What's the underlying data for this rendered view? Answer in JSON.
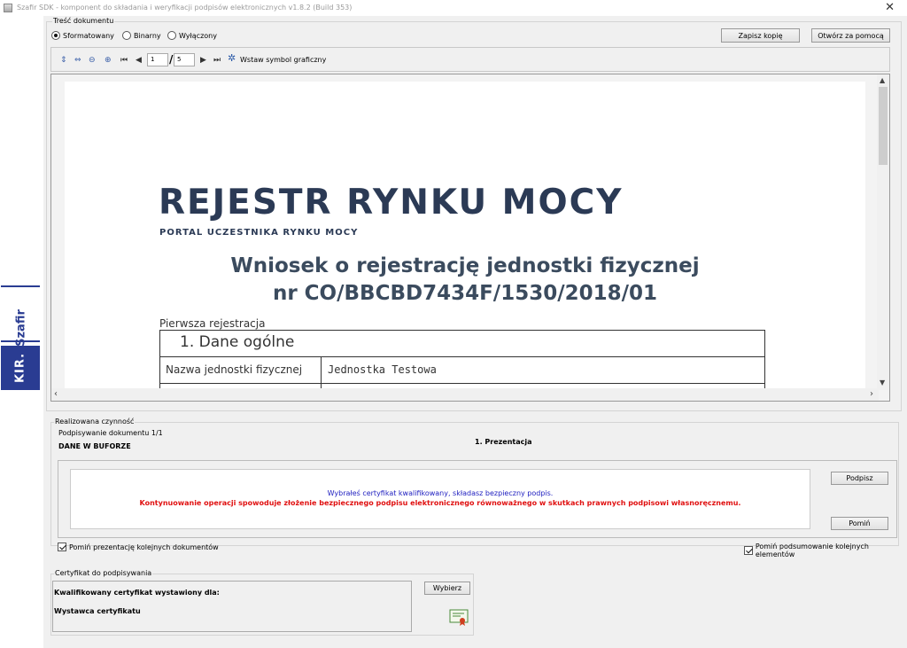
{
  "window": {
    "title": "Szafir SDK - komponent do składania i weryfikacji podpisów elektronicznych v1.8.2 (Build 353)",
    "close_glyph": "✕"
  },
  "brand": {
    "product": "Szafir",
    "company": "KIR."
  },
  "content_group": {
    "label": "Treść dokumentu",
    "radios": [
      {
        "label": "Sformatowany",
        "selected": true
      },
      {
        "label": "Binarny",
        "selected": false
      },
      {
        "label": "Wyłączony",
        "selected": false
      }
    ],
    "save_copy_label": "Zapisz kopię",
    "open_with_label": "Otwórz za pomocą"
  },
  "toolbar": {
    "page_current": "1",
    "page_separator": "/",
    "page_total": "5",
    "insert_symbol_label": "Wstaw symbol graficzny"
  },
  "document": {
    "logo_title": "REJESTR RYNKU MOCY",
    "logo_subtitle": "PORTAL UCZESTNIKA RYNKU MOCY",
    "heading_line1": "Wniosek o rejestrację jednostki fizycznej",
    "heading_line2": "nr CO/BBCBD7434F/1530/2018/01",
    "first_registration": "Pierwsza rejestracja",
    "section_title": "1. Dane ogólne",
    "field_label": "Nazwa jednostki fizycznej",
    "field_value": "Jednostka Testowa"
  },
  "action_group": {
    "label": "Realizowana czynność",
    "progress": "Podpisywanie dokumentu 1/1",
    "buffer_label": "DANE W BUFORZE",
    "stage": "1. Prezentacja",
    "info_message": "Wybrałeś certyfikat kwalifikowany, składasz bezpieczny podpis.",
    "warning_message": "Kontynuowanie operacji spowoduje złożenie bezpiecznego podpisu elektronicznego równoważnego w skutkach prawnych podpisowi własnoręcznemu.",
    "sign_label": "Podpisz",
    "skip_label": "Pomiń"
  },
  "options": {
    "skip_presentation_label": "Pomiń prezentację kolejnych dokumentów",
    "skip_summary_label": "Pomiń podsumowanie kolejnych elementów"
  },
  "certificate_group": {
    "label": "Certyfikat do podpisywania",
    "issued_for_label": "Kwalifikowany certyfikat wystawiony dla:",
    "issuer_label": "Wystawca certyfikatu",
    "choose_label": "Wybierz"
  },
  "colors": {
    "brand_blue": "#2a3c92",
    "info_blue": "#2020c0",
    "warning_red": "#e01010",
    "document_text": "#2b3a55"
  }
}
